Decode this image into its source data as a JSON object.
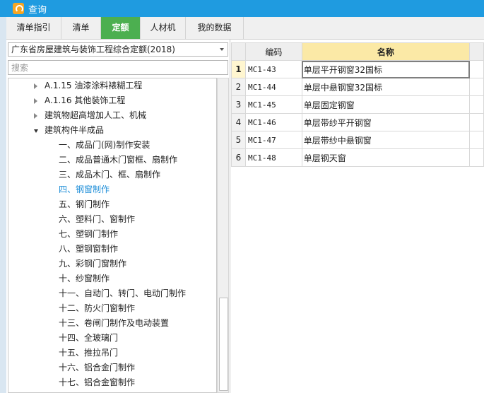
{
  "window": {
    "title": "查询",
    "accent": "#1f9be0"
  },
  "tabs": [
    {
      "label": "清单指引",
      "active": false
    },
    {
      "label": "清单",
      "active": false
    },
    {
      "label": "定额",
      "active": true
    },
    {
      "label": "人材机",
      "active": false
    },
    {
      "label": "我的数据",
      "active": false
    }
  ],
  "left": {
    "dropdown_value": "广东省房屋建筑与装饰工程综合定额(2018)",
    "search_placeholder": "搜索",
    "tree": [
      {
        "label": "A.1.15 油漆涂料裱糊工程",
        "level": 1,
        "state": "collapsed"
      },
      {
        "label": "A.1.16 其他装饰工程",
        "level": 1,
        "state": "collapsed"
      },
      {
        "label": "建筑物超高增加人工、机械",
        "level": 1,
        "state": "collapsed"
      },
      {
        "label": "建筑构件半成品",
        "level": 1,
        "state": "expanded"
      },
      {
        "label": "一、成品门(网)制作安装",
        "level": 2
      },
      {
        "label": "二、成品普通木门窗框、扇制作",
        "level": 2
      },
      {
        "label": "三、成品木门、框、扇制作",
        "level": 2
      },
      {
        "label": "四、钢窗制作",
        "level": 2,
        "selected": true
      },
      {
        "label": "五、钢门制作",
        "level": 2
      },
      {
        "label": "六、塑料门、窗制作",
        "level": 2
      },
      {
        "label": "七、塑钢门制作",
        "level": 2
      },
      {
        "label": "八、塑钢窗制作",
        "level": 2
      },
      {
        "label": "九、彩钢门窗制作",
        "level": 2
      },
      {
        "label": "十、纱窗制作",
        "level": 2
      },
      {
        "label": "十一、自动门、转门、电动门制作",
        "level": 2
      },
      {
        "label": "十二、防火门窗制作",
        "level": 2
      },
      {
        "label": "十三、卷闸门制作及电动装置",
        "level": 2
      },
      {
        "label": "十四、全玻璃门",
        "level": 2
      },
      {
        "label": "十五、推拉吊门",
        "level": 2
      },
      {
        "label": "十六、铝合金门制作",
        "level": 2
      },
      {
        "label": "十七、铝合金窗制作",
        "level": 2
      }
    ]
  },
  "grid": {
    "headers": {
      "code": "编码",
      "name": "名称"
    },
    "rows": [
      {
        "idx": "1",
        "code": "MC1-43",
        "name": "单层平开钢窗32国标",
        "current": true
      },
      {
        "idx": "2",
        "code": "MC1-44",
        "name": "单层中悬钢窗32国标"
      },
      {
        "idx": "3",
        "code": "MC1-45",
        "name": "单层固定钢窗"
      },
      {
        "idx": "4",
        "code": "MC1-46",
        "name": "单层带纱平开钢窗"
      },
      {
        "idx": "5",
        "code": "MC1-47",
        "name": "单层带纱中悬钢窗"
      },
      {
        "idx": "6",
        "code": "MC1-48",
        "name": "单层钢天窗"
      }
    ]
  }
}
